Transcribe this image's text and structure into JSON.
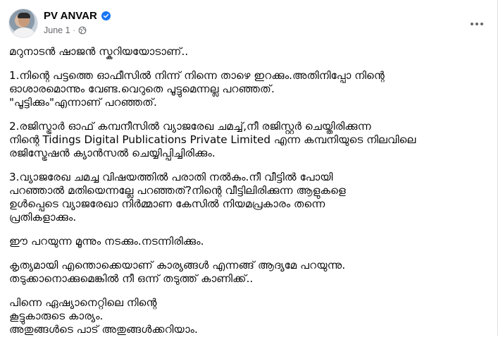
{
  "post": {
    "author": "PV ANVAR",
    "date": "June 1",
    "meta_separator": "·",
    "paragraphs": [
      "മറുനാടൻ ഷാജൻ സ്കറിയയോടാണ്..",
      "1.നിന്റെ പട്ടത്തെ ഓഫീസിൽ നിന്ന് നിന്നെ താഴെ ഇറക്കും.അതിനിപ്പോ നിന്റെ\nഓശാരമൊന്നും വേണ്ട.വെറുതെ പൂട്ടുമെന്നല്ല പറഞ്ഞത്.\n\"പൂട്ടിക്കും\"എന്നാണ് പറഞ്ഞത്.",
      "2.രജിസ്ട്രാർ ഓഫ് കമ്പനീസിൽ വ്യാജരേഖ ചമച്ച്,നീ രജിസ്റ്റർ ചെയ്തിരിക്കുന്ന\nനിന്റെ Tidings Digital Publications Private Limited എന്ന കമ്പനിയുടെ നിലവിലെ\nരജിസ്ട്രേഷൻ ക്യാൻസൽ ചെയ്യിപ്പിച്ചിരിക്കും.",
      "3.വ്യാജരേഖ ചമച്ച വിഷയത്തിൽ പരാതി നൽകും.നീ വീട്ടിൽ പോയി\nപറഞ്ഞാൽ മതിയെന്നല്ലേ പറഞ്ഞത്?നിന്റെ വീട്ടിലിരിക്കുന്ന ആളുകളെ\nഉൾപ്പെടെ വ്യാജരേഖാ നിർമ്മാണ കേസിൽ നിയമപ്രകാരം തന്നെ\nപ്രതികളാക്കും.",
      "ഈ പറയുന്ന മൂന്നും നടക്കും.നടന്നിരിക്കും.",
      "കൃത്യമായി എന്തൊക്കെയാണ് കാര്യങ്ങൾ എന്നങ്ങ് ആദ്യമേ പറയുന്നു.\nതടുക്കാനൊക്കുമെങ്കിൽ നീ ഒന്ന് തടുത്ത് കാണിക്ക്..",
      "പിന്നെ ഏഷ്യാനെറ്റിലെ നിന്റെ\nകൂട്ടുകാരുടെ കാര്യം.\nഅതുങ്ങൾടെ പാട് അതുങ്ങൾക്കറിയാം."
    ]
  },
  "icons": {
    "verified": "verified-badge-icon",
    "audience": "globe-icon",
    "more": "more-options-icon"
  },
  "colors": {
    "verified_blue": "#1877f2",
    "meta_gray": "#65676b",
    "text": "#050505"
  }
}
